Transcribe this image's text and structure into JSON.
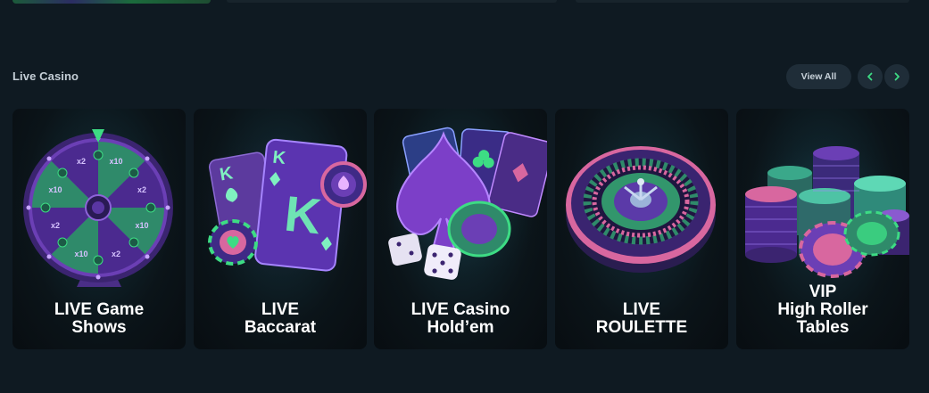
{
  "section": {
    "title": "Live Casino",
    "view_all_label": "View All"
  },
  "cards": [
    {
      "lines": [
        "LIVE Game",
        "Shows"
      ],
      "icon": "wheel-of-fortune-icon",
      "wheel_labels": [
        "x2",
        "x10",
        "x2",
        "x10",
        "x2",
        "x10",
        "x2",
        "x10"
      ]
    },
    {
      "lines": [
        "LIVE",
        "Baccarat"
      ],
      "icon": "playing-cards-icon",
      "card_letter": "K"
    },
    {
      "lines": [
        "LIVE Casino",
        "Hold’em"
      ],
      "icon": "spade-dice-icon"
    },
    {
      "lines": [
        "LIVE",
        "ROULETTE"
      ],
      "icon": "roulette-wheel-icon"
    },
    {
      "lines": [
        "VIP",
        "High Roller",
        "Tables"
      ],
      "icon": "chip-stacks-icon"
    }
  ],
  "colors": {
    "background": "#0f1a22",
    "accent_green": "#3ddc84",
    "purple": "#6b3fb5",
    "pink": "#d8679f"
  }
}
